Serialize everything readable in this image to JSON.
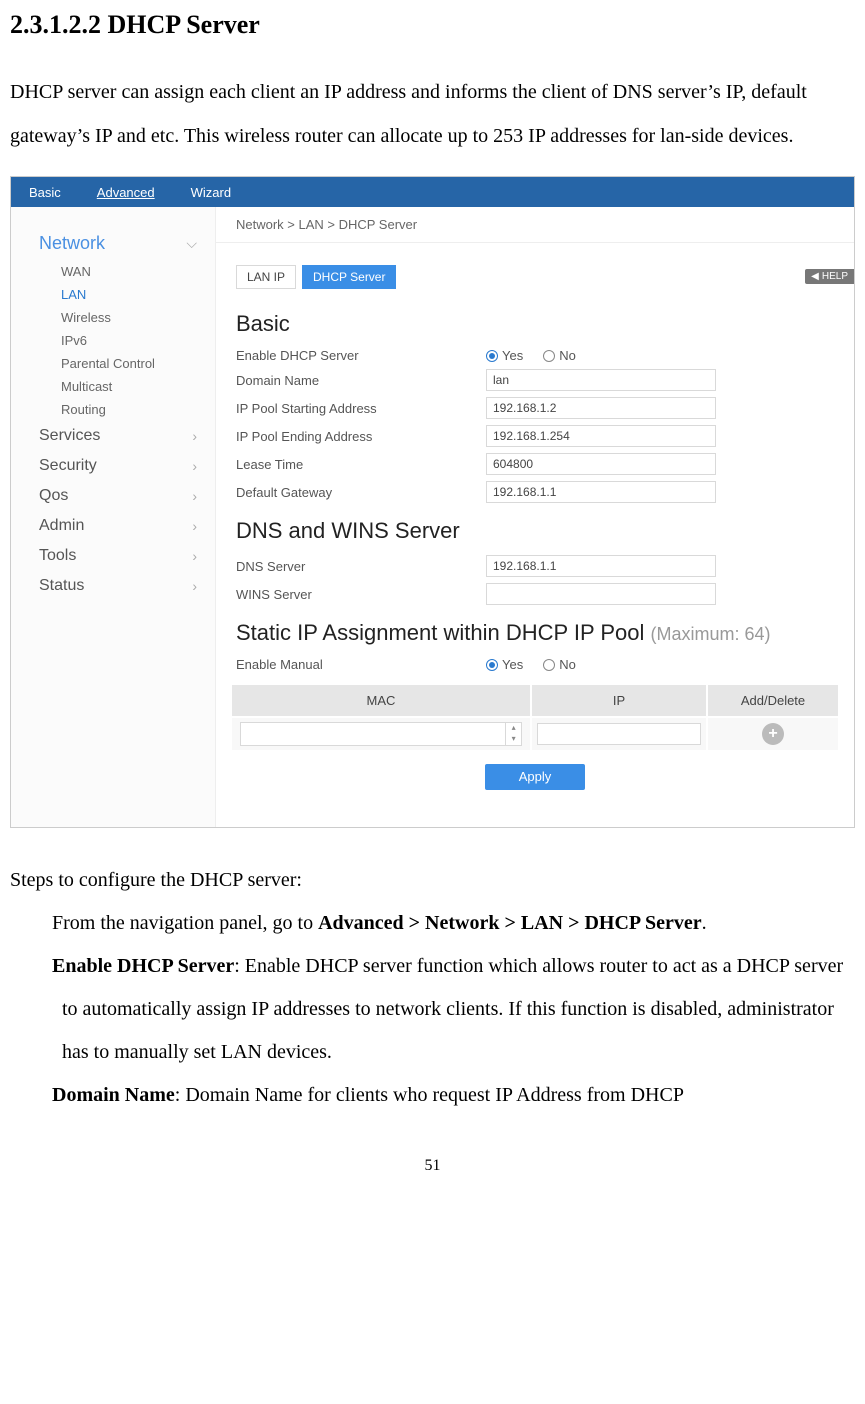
{
  "doc": {
    "heading": "2.3.1.2.2 DHCP Server",
    "paragraph": "DHCP server can assign each client an IP address and informs the client of DNS server’s IP, default gateway’s IP and etc. This wireless router can allocate up to 253 IP addresses for lan-side devices.",
    "steps_intro": "Steps to configure the DHCP server:",
    "step1_pre": "From the navigation panel, go to ",
    "step1_bold": "Advanced > Network > LAN > DHCP Server",
    "step1_post": ".",
    "step2_bold": "Enable DHCP Server",
    "step2_rest": ": Enable DHCP server function which allows router to act as a DHCP server to automatically assign IP addresses to network clients. If this function is disabled, administrator has to manually set LAN devices.",
    "step3_bold": "Domain Name",
    "step3_rest": ": Domain Name for clients who request IP Address from DHCP",
    "page_number": "51"
  },
  "app": {
    "tabs": {
      "basic": "Basic",
      "advanced": "Advanced",
      "wizard": "Wizard"
    },
    "breadcrumb": "Network > LAN > DHCP Server",
    "sidebar": {
      "sections": [
        {
          "label": "Network",
          "open": true
        },
        {
          "label": "Services"
        },
        {
          "label": "Security"
        },
        {
          "label": "Qos"
        },
        {
          "label": "Admin"
        },
        {
          "label": "Tools"
        },
        {
          "label": "Status"
        }
      ],
      "network_items": [
        {
          "label": "WAN"
        },
        {
          "label": "LAN",
          "selected": true
        },
        {
          "label": "Wireless"
        },
        {
          "label": "IPv6"
        },
        {
          "label": "Parental Control"
        },
        {
          "label": "Multicast"
        },
        {
          "label": "Routing"
        }
      ]
    },
    "lan_tabs": {
      "lanip": "LAN IP",
      "dhcp": "DHCP Server"
    },
    "help_label": "HELP",
    "sections": {
      "basic_title": "Basic",
      "dns_title": "DNS and WINS Server",
      "static_title_main": "Static IP Assignment within DHCP IP Pool ",
      "static_title_muted": "(Maximum: 64)"
    },
    "form": {
      "enable_dhcp_label": "Enable DHCP Server",
      "yes": "Yes",
      "no": "No",
      "domain_label": "Domain Name",
      "domain_value": "lan",
      "start_label": "IP Pool Starting Address",
      "start_value": "192.168.1.2",
      "end_label": "IP Pool Ending Address",
      "end_value": "192.168.1.254",
      "lease_label": "Lease Time",
      "lease_value": "604800",
      "gw_label": "Default Gateway",
      "gw_value": "192.168.1.1",
      "dns_label": "DNS Server",
      "dns_value": "192.168.1.1",
      "wins_label": "WINS Server",
      "wins_value": "",
      "manual_label": "Enable Manual"
    },
    "table": {
      "mac": "MAC",
      "ip": "IP",
      "add_del": "Add/Delete"
    },
    "apply": "Apply"
  }
}
